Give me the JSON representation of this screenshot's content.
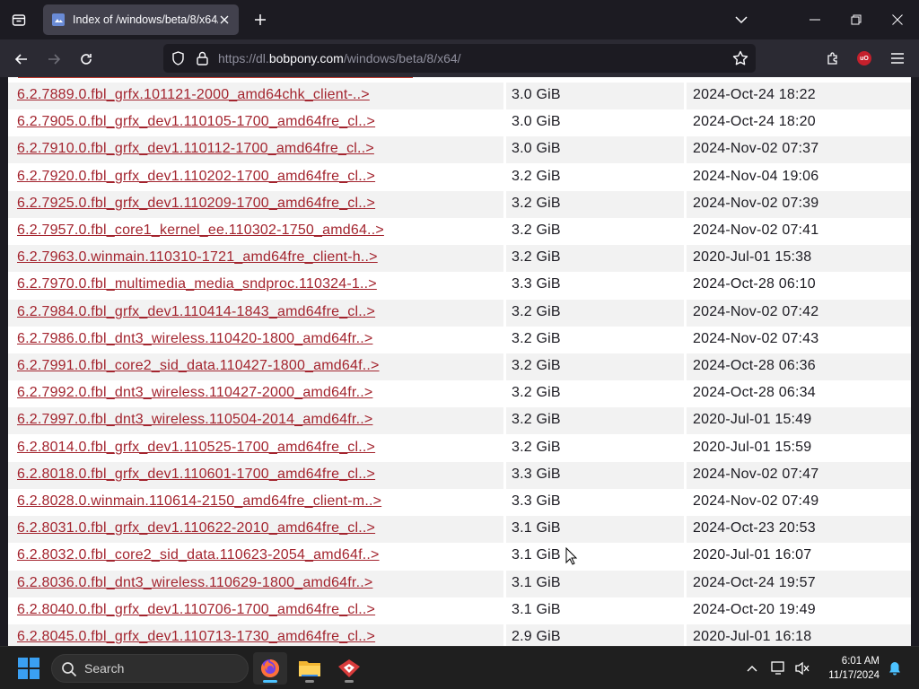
{
  "browser": {
    "tab_title": "Index of /windows/beta/8/x64/",
    "url_prefix": "https://dl.",
    "url_host": "bobpony.com",
    "url_path": "/windows/beta/8/x64/"
  },
  "listing": {
    "rows": [
      {
        "name": "6.2.7889.0.fbl_grfx.101121-2000_amd64chk_client-..>",
        "size": "3.0 GiB",
        "date": "2024-Oct-24 18:22"
      },
      {
        "name": "6.2.7905.0.fbl_grfx_dev1.110105-1700_amd64fre_cl..>",
        "size": "3.0 GiB",
        "date": "2024-Oct-24 18:20"
      },
      {
        "name": "6.2.7910.0.fbl_grfx_dev1.110112-1700_amd64fre_cl..>",
        "size": "3.0 GiB",
        "date": "2024-Nov-02 07:37"
      },
      {
        "name": "6.2.7920.0.fbl_grfx_dev1.110202-1700_amd64fre_cl..>",
        "size": "3.2 GiB",
        "date": "2024-Nov-04 19:06"
      },
      {
        "name": "6.2.7925.0.fbl_grfx_dev1.110209-1700_amd64fre_cl..>",
        "size": "3.2 GiB",
        "date": "2024-Nov-02 07:39"
      },
      {
        "name": "6.2.7957.0.fbl_core1_kernel_ee.110302-1750_amd64..>",
        "size": "3.2 GiB",
        "date": "2024-Nov-02 07:41"
      },
      {
        "name": "6.2.7963.0.winmain.110310-1721_amd64fre_client-h..>",
        "size": "3.2 GiB",
        "date": "2020-Jul-01 15:38"
      },
      {
        "name": "6.2.7970.0.fbl_multimedia_media_sndproc.110324-1..>",
        "size": "3.3 GiB",
        "date": "2024-Oct-28 06:10"
      },
      {
        "name": "6.2.7984.0.fbl_grfx_dev1.110414-1843_amd64fre_cl..>",
        "size": "3.2 GiB",
        "date": "2024-Nov-02 07:42"
      },
      {
        "name": "6.2.7986.0.fbl_dnt3_wireless.110420-1800_amd64fr..>",
        "size": "3.2 GiB",
        "date": "2024-Nov-02 07:43"
      },
      {
        "name": "6.2.7991.0.fbl_core2_sid_data.110427-1800_amd64f..>",
        "size": "3.2 GiB",
        "date": "2024-Oct-28 06:36"
      },
      {
        "name": "6.2.7992.0.fbl_dnt3_wireless.110427-2000_amd64fr..>",
        "size": "3.2 GiB",
        "date": "2024-Oct-28 06:34"
      },
      {
        "name": "6.2.7997.0.fbl_dnt3_wireless.110504-2014_amd64fr..>",
        "size": "3.2 GiB",
        "date": "2020-Jul-01 15:49"
      },
      {
        "name": "6.2.8014.0.fbl_grfx_dev1.110525-1700_amd64fre_cl..>",
        "size": "3.2 GiB",
        "date": "2020-Jul-01 15:59"
      },
      {
        "name": "6.2.8018.0.fbl_grfx_dev1.110601-1700_amd64fre_cl..>",
        "size": "3.3 GiB",
        "date": "2024-Nov-02 07:47"
      },
      {
        "name": "6.2.8028.0.winmain.110614-2150_amd64fre_client-m..>",
        "size": "3.3 GiB",
        "date": "2024-Nov-02 07:49"
      },
      {
        "name": "6.2.8031.0.fbl_grfx_dev1.110622-2010_amd64fre_cl..>",
        "size": "3.1 GiB",
        "date": "2024-Oct-23 20:53"
      },
      {
        "name": "6.2.8032.0.fbl_core2_sid_data.110623-2054_amd64f..>",
        "size": "3.1 GiB",
        "date": "2020-Jul-01 16:07"
      },
      {
        "name": "6.2.8036.0.fbl_dnt3_wireless.110629-1800_amd64fr..>",
        "size": "3.1 GiB",
        "date": "2024-Oct-24 19:57"
      },
      {
        "name": "6.2.8040.0.fbl_grfx_dev1.110706-1700_amd64fre_cl..>",
        "size": "3.1 GiB",
        "date": "2024-Oct-20 19:49"
      },
      {
        "name": "6.2.8045.0.fbl_grfx_dev1.110713-1730_amd64fre_cl..>",
        "size": "2.9 GiB",
        "date": "2020-Jul-01 16:18"
      }
    ]
  },
  "taskbar": {
    "search_label": "Search",
    "time": "6:01 AM",
    "date": "11/17/2024"
  },
  "colors": {
    "link": "#a3242e",
    "stripe": "#f2f2f2",
    "accent": "#4cc2ff"
  }
}
